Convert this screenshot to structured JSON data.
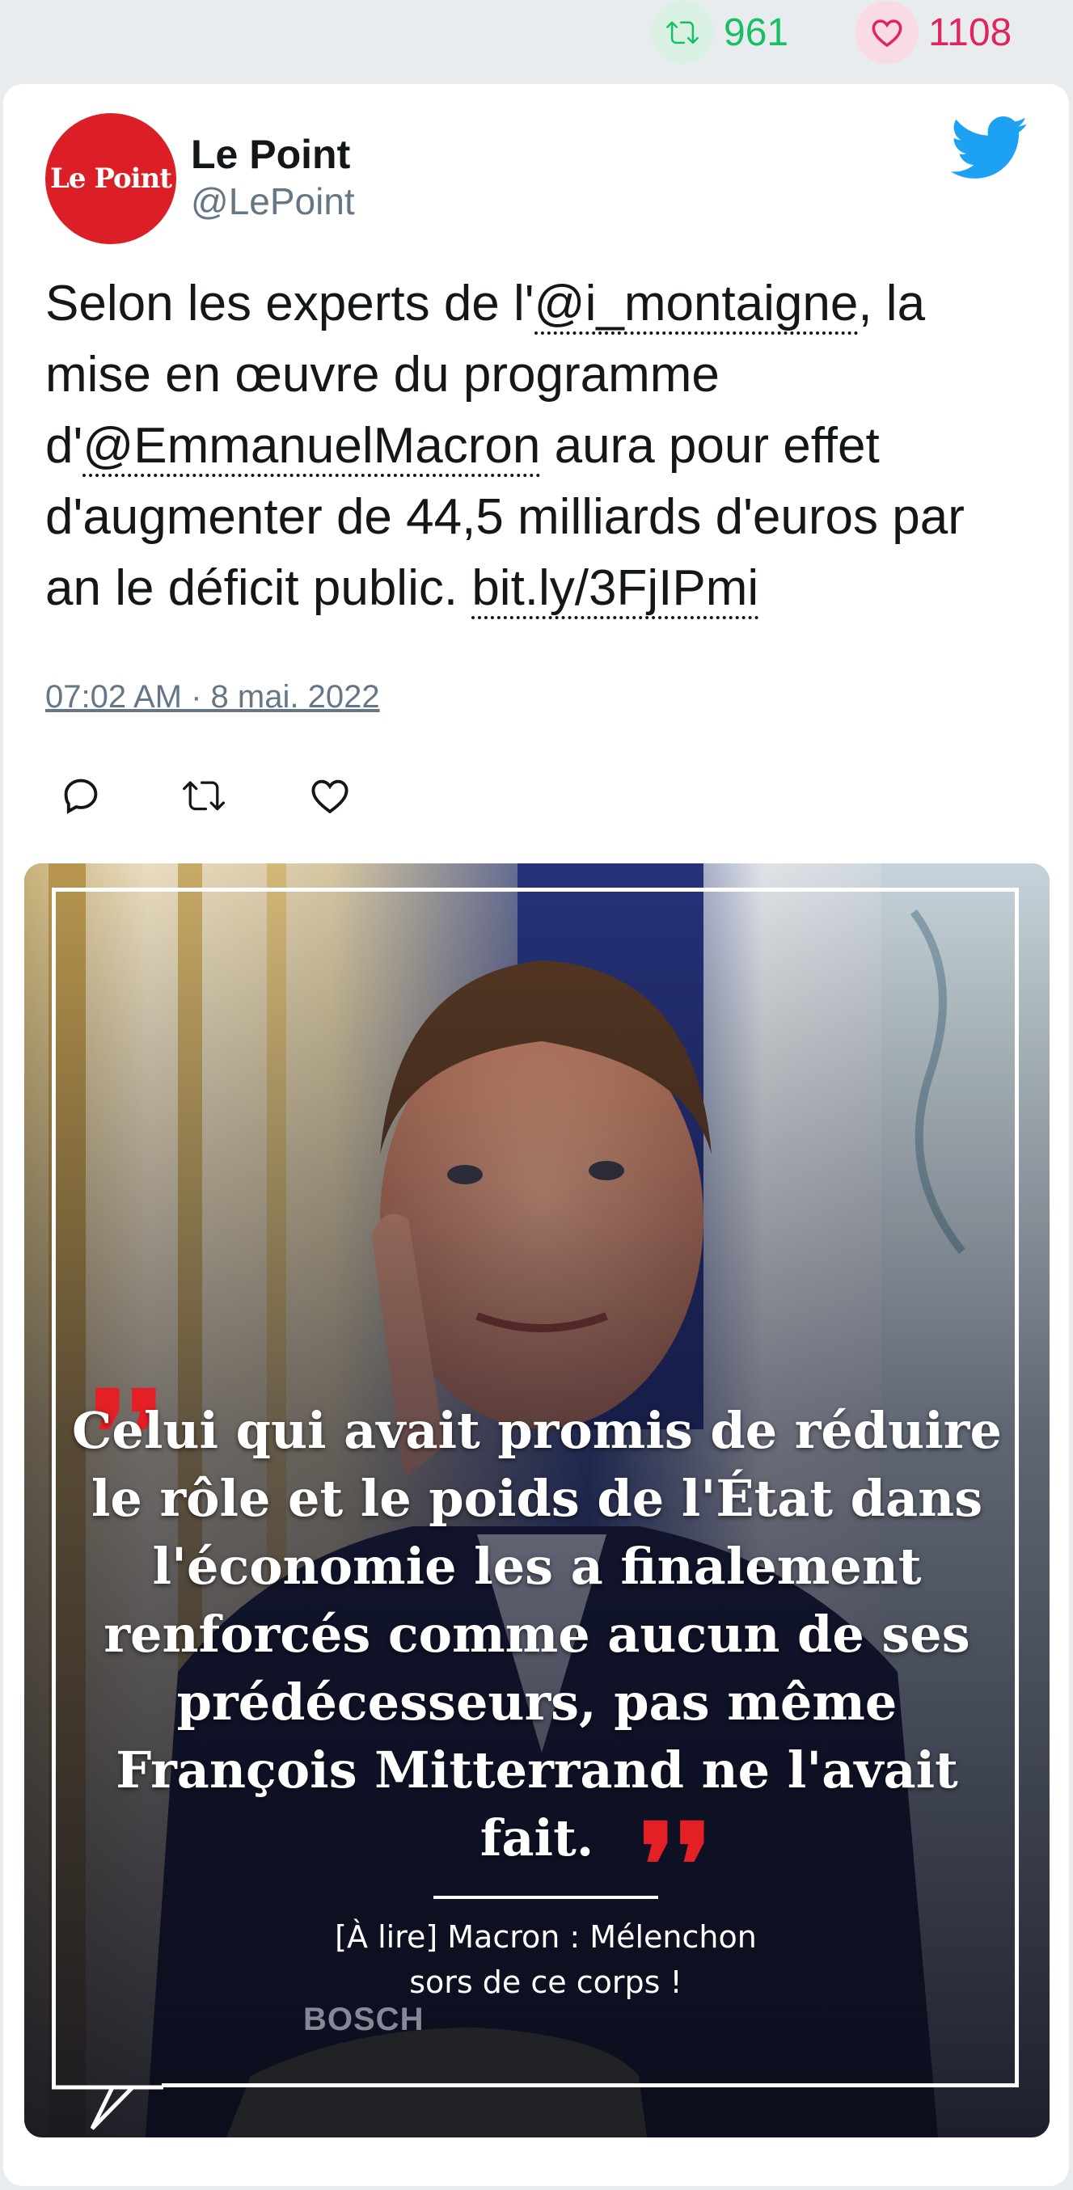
{
  "stats": {
    "retweets": "961",
    "likes": "1108",
    "retweet_color": "#17bf63",
    "like_color": "#e0245e"
  },
  "tweet": {
    "avatar_text": "Le Point",
    "author_name": "Le Point",
    "author_handle": "@LePoint",
    "text_part1": "Selon les experts de l'",
    "mention1": "@i_montaigne",
    "text_part2": ", la mise en œuvre du programme d'",
    "mention2": "@EmmanuelMacron",
    "text_part3": " aura pour effet d'augmenter de 44,5 milliards d'euros par an le déficit public. ",
    "url": "bit.ly/3FjIPmi",
    "timestamp": "07:02 AM · 8 mai. 2022",
    "icons": [
      "reply-icon",
      "retweet-icon",
      "like-icon",
      "twitter-bird-icon"
    ]
  },
  "media": {
    "quote": "Celui qui avait promis de réduire le rôle et le poids de l'État dans l'économie les a finalement renforcés comme aucun de ses prédécesseurs, pas même François Mitterrand ne l'avait fait.",
    "open_quote": "❜❜",
    "close_quote": "❜❜",
    "caption_line1": "[À lire] Macron : Mélenchon",
    "caption_line2": "sors de ce corps !",
    "mic_brand": "BOSCH",
    "quote_color": "#e41f26"
  }
}
